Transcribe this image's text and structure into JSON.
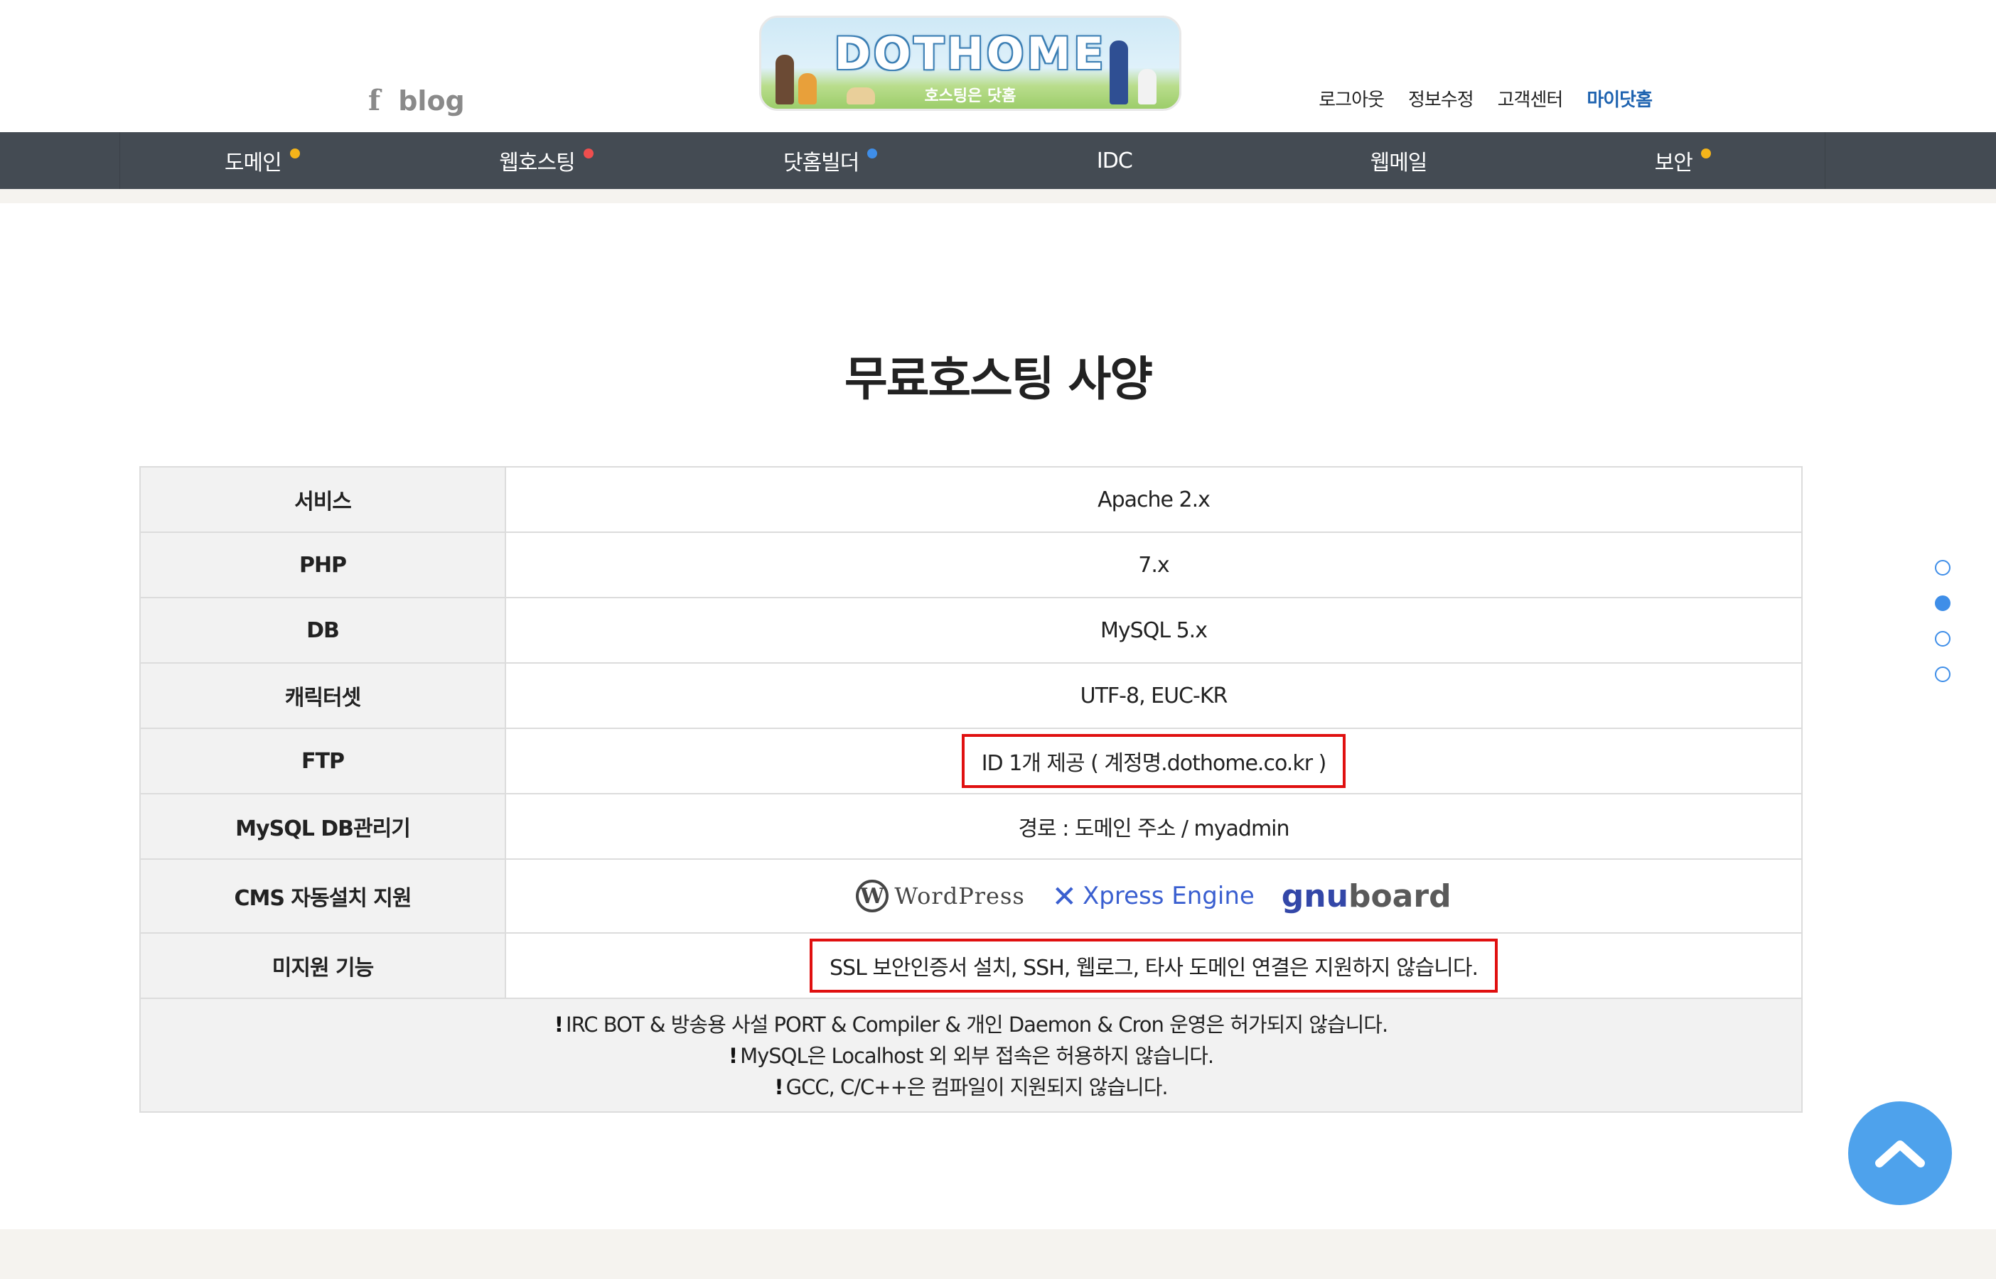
{
  "header": {
    "social": {
      "facebook": "f",
      "blog": "blog"
    },
    "logo": {
      "title": "DOTHOME",
      "subtitle": "호스팅은 닷홈"
    },
    "links": [
      "로그아웃",
      "정보수정",
      "고객센터",
      "마이닷홈"
    ]
  },
  "nav": {
    "items": [
      {
        "label": "도메인",
        "dot": "#f4b41a"
      },
      {
        "label": "웹호스팅",
        "dot": "#ef4e4e"
      },
      {
        "label": "닷홈빌더",
        "dot": "#3f8ee8"
      },
      {
        "label": "IDC",
        "dot": ""
      },
      {
        "label": "웹메일",
        "dot": ""
      },
      {
        "label": "보안",
        "dot": "#f4b41a"
      }
    ]
  },
  "title": "무료호스팅 사양",
  "spec": {
    "rows": [
      {
        "label": "서비스",
        "value": "Apache 2.x"
      },
      {
        "label": "PHP",
        "value": "7.x"
      },
      {
        "label": "DB",
        "value": "MySQL 5.x"
      },
      {
        "label": "캐릭터셋",
        "value": "UTF-8, EUC-KR"
      },
      {
        "label": "FTP",
        "value": "ID 1개 제공 ( 계정명.dothome.co.kr )"
      },
      {
        "label": "MySQL DB관리기",
        "value": "경로 : 도메인 주소 / myadmin"
      },
      {
        "label": "CMS 자동설치 지원",
        "value": ""
      },
      {
        "label": "미지원 기능",
        "value": "SSL 보안인증서 설치, SSH, 웹로그, 타사 도메인 연결은 지원하지 않습니다."
      }
    ],
    "cms": {
      "wordpress": "WordPress",
      "xe": "Xpress Engine",
      "gnu_a": "gnu",
      "gnu_b": "board"
    },
    "notes": [
      "IRC BOT & 방송용 사설 PORT & Compiler & 개인 Daemon & Cron 운영은 허가되지 않습니다.",
      "MySQL은 Localhost 외 외부 접속은 허용하지 않습니다.",
      "GCC, C/C++은 컴파일이 지원되지 않습니다."
    ]
  },
  "colors": {
    "nav_bg": "#444b53",
    "accent": "#3f8ee8",
    "highlight_border": "#e01010"
  }
}
